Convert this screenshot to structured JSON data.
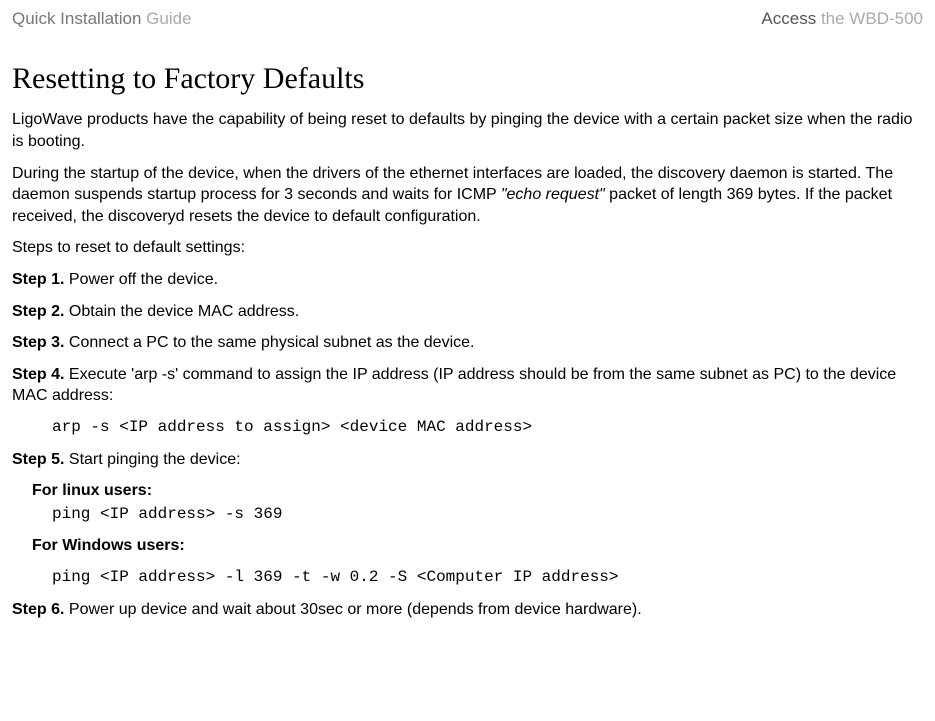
{
  "header": {
    "left_part1": "Quick Installation",
    "left_part2": " Guide",
    "right_part1": "Access ",
    "right_part2": "the WBD-500"
  },
  "title": "Resetting to Factory Defaults",
  "intro1": "LigoWave products have the capability of being reset to defaults by pinging the device with a certain packet size when the radio is booting.",
  "intro2_a": "During the startup of the device, when the drivers of the ethernet interfaces are loaded, the discovery daemon is started. The daemon suspends startup process for 3 seconds and waits for ICMP ",
  "intro2_b": "\"echo request\"",
  "intro2_c": " packet of length 369 bytes. If the packet received, the discoveryd resets the device to default configuration.",
  "steps_intro": "Steps to reset to default settings:",
  "step1_label": "Step 1.",
  "step1_text": " Power off the device.",
  "step2_label": "Step 2.",
  "step2_text": " Obtain the device MAC address.",
  "step3_label": "Step 3.",
  "step3_text": " Connect a PC to the same physical subnet as the device.",
  "step4_label": "Step 4.",
  "step4_text": " Execute 'arp -s' command to assign the IP address (IP address should be from the same subnet as PC) to the device MAC address:",
  "step4_code": "arp -s <IP address to assign> <device MAC address>",
  "step5_label": "Step 5.",
  "step5_text": " Start pinging the device:",
  "linux_heading": "For linux users:",
  "linux_code": "ping <IP address> -s 369",
  "windows_heading": "For Windows users:",
  "windows_code": "ping <IP address> -l 369 -t -w 0.2 -S <Computer IP address>",
  "step6_label": "Step 6.",
  "step6_text": " Power up device and wait about 30sec or more (depends from device hardware)."
}
